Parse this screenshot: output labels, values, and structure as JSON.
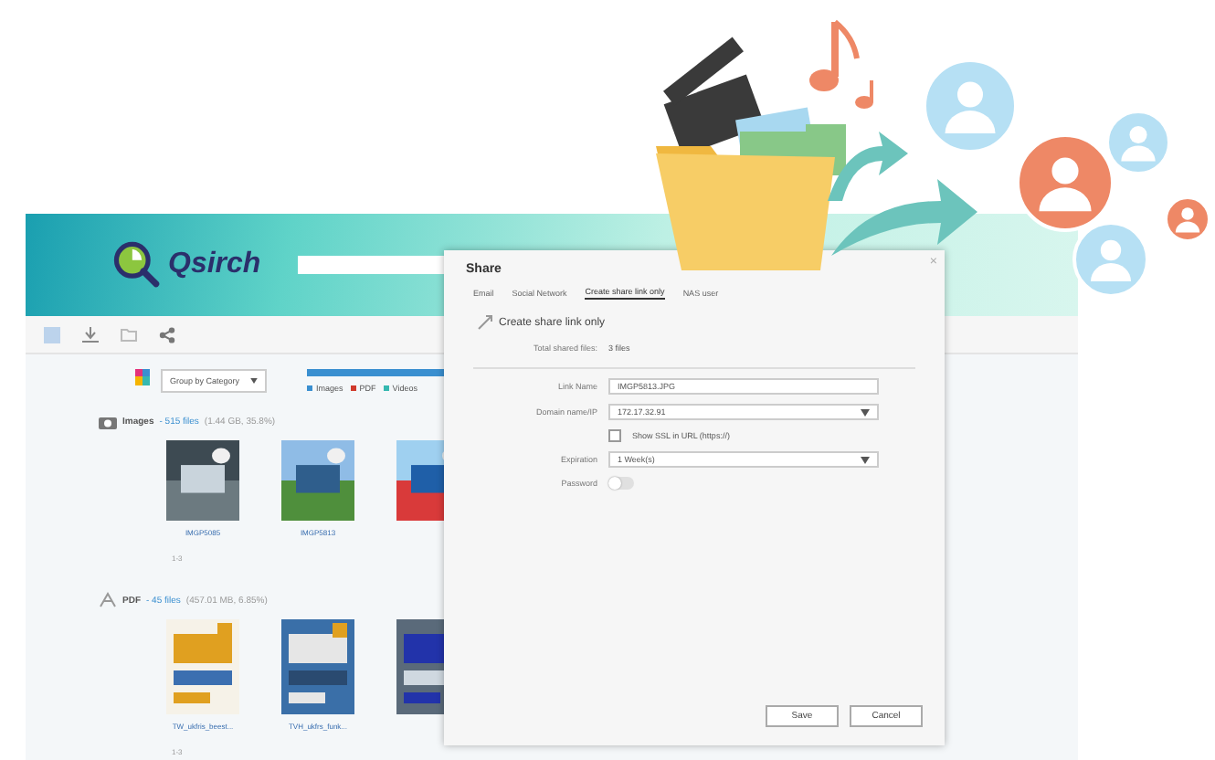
{
  "app": {
    "logo": "Qsirch"
  },
  "toolbar": {
    "group_select": "Group by Category",
    "legend": [
      {
        "label": "Images",
        "color": "#3a8fd0"
      },
      {
        "label": "PDF",
        "color": "#d0392b"
      },
      {
        "label": "Videos",
        "color": "#35b8b0"
      }
    ]
  },
  "sections": [
    {
      "title": "Images",
      "count": "- 515 files",
      "size": "(1.44 GB, 35.8%)",
      "items": [
        {
          "kind": "picture",
          "caption": "IMGP5085"
        },
        {
          "kind": "picture",
          "caption": "IMGP5813"
        },
        {
          "kind": "picture"
        }
      ],
      "pager": "1-3"
    },
    {
      "kind": "pdf",
      "title": "PDF",
      "count": "- 45 files",
      "size": "(457.01 MB, 6.85%)",
      "items": [
        {
          "kind": "picture",
          "caption": "TW_ukfris_beest..."
        },
        {
          "kind": "picture",
          "caption": "TVH_ukfrs_funk..."
        },
        {
          "kind": "picture"
        }
      ],
      "pager": "1-3"
    }
  ],
  "dialog": {
    "title": "Share",
    "close": "×",
    "tabs": [
      {
        "label": "Email",
        "selected": false
      },
      {
        "label": "Social Network",
        "selected": false
      },
      {
        "label": "Create share link only",
        "selected": true
      },
      {
        "label": "NAS user",
        "selected": false
      }
    ],
    "heading": "Create share link only",
    "summary": {
      "label": "Total shared files:",
      "value": "3 files"
    },
    "fields": [
      {
        "kind": "input",
        "label": "Link Name",
        "value": "IMGP5813.JPG"
      },
      {
        "kind": "select",
        "label": "Domain name/IP",
        "value": "172.17.32.91"
      },
      {
        "kind": "checkbox",
        "label": "Show SSL in URL (https://)",
        "checked": false
      },
      {
        "kind": "select",
        "label": "Expiration",
        "value": "1 Week(s)"
      },
      {
        "kind": "toggle",
        "label": "Password",
        "on": false
      }
    ],
    "buttons": [
      "Save",
      "Cancel"
    ]
  }
}
